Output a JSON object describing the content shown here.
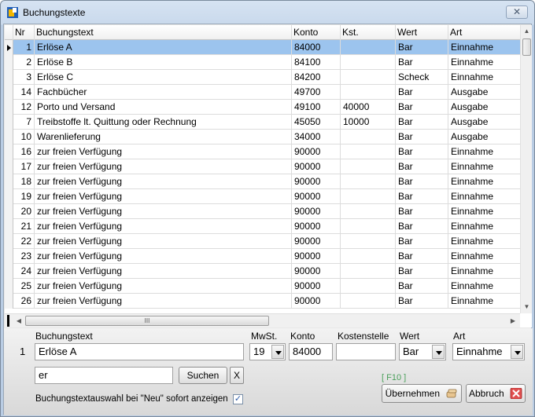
{
  "window": {
    "title": "Buchungstexte",
    "close_label": "✕"
  },
  "grid": {
    "columns": {
      "nr": "Nr",
      "text": "Buchungstext",
      "konto": "Konto",
      "kst": "Kst.",
      "wert": "Wert",
      "art": "Art"
    },
    "rows": [
      {
        "nr": "1",
        "text": "Erlöse A",
        "konto": "84000",
        "kst": "",
        "wert": "Bar",
        "art": "Einnahme"
      },
      {
        "nr": "2",
        "text": "Erlöse B",
        "konto": "84100",
        "kst": "",
        "wert": "Bar",
        "art": "Einnahme"
      },
      {
        "nr": "3",
        "text": "Erlöse C",
        "konto": "84200",
        "kst": "",
        "wert": "Scheck",
        "art": "Einnahme"
      },
      {
        "nr": "14",
        "text": "Fachbücher",
        "konto": "49700",
        "kst": "",
        "wert": "Bar",
        "art": "Ausgabe"
      },
      {
        "nr": "12",
        "text": "Porto und Versand",
        "konto": "49100",
        "kst": "40000",
        "wert": "Bar",
        "art": "Ausgabe"
      },
      {
        "nr": "7",
        "text": "Treibstoffe lt. Quittung oder Rechnung",
        "konto": "45050",
        "kst": "10000",
        "wert": "Bar",
        "art": "Ausgabe"
      },
      {
        "nr": "10",
        "text": "Warenlieferung",
        "konto": "34000",
        "kst": "",
        "wert": "Bar",
        "art": "Ausgabe"
      },
      {
        "nr": "16",
        "text": "zur freien Verfügung",
        "konto": "90000",
        "kst": "",
        "wert": "Bar",
        "art": "Einnahme"
      },
      {
        "nr": "17",
        "text": "zur freien Verfügung",
        "konto": "90000",
        "kst": "",
        "wert": "Bar",
        "art": "Einnahme"
      },
      {
        "nr": "18",
        "text": "zur freien Verfügung",
        "konto": "90000",
        "kst": "",
        "wert": "Bar",
        "art": "Einnahme"
      },
      {
        "nr": "19",
        "text": "zur freien Verfügung",
        "konto": "90000",
        "kst": "",
        "wert": "Bar",
        "art": "Einnahme"
      },
      {
        "nr": "20",
        "text": "zur freien Verfügung",
        "konto": "90000",
        "kst": "",
        "wert": "Bar",
        "art": "Einnahme"
      },
      {
        "nr": "21",
        "text": "zur freien Verfügung",
        "konto": "90000",
        "kst": "",
        "wert": "Bar",
        "art": "Einnahme"
      },
      {
        "nr": "22",
        "text": "zur freien Verfügung",
        "konto": "90000",
        "kst": "",
        "wert": "Bar",
        "art": "Einnahme"
      },
      {
        "nr": "23",
        "text": "zur freien Verfügung",
        "konto": "90000",
        "kst": "",
        "wert": "Bar",
        "art": "Einnahme"
      },
      {
        "nr": "24",
        "text": "zur freien Verfügung",
        "konto": "90000",
        "kst": "",
        "wert": "Bar",
        "art": "Einnahme"
      },
      {
        "nr": "25",
        "text": "zur freien Verfügung",
        "konto": "90000",
        "kst": "",
        "wert": "Bar",
        "art": "Einnahme"
      },
      {
        "nr": "26",
        "text": "zur freien Verfügung",
        "konto": "90000",
        "kst": "",
        "wert": "Bar",
        "art": "Einnahme"
      }
    ],
    "selected_row": 0,
    "hscroll_grip": "III"
  },
  "editor": {
    "labels": {
      "text": "Buchungstext",
      "mwst": "MwSt.",
      "konto": "Konto",
      "kst": "Kostenstelle",
      "wert": "Wert",
      "art": "Art"
    },
    "nr": "1",
    "text": "Erlöse A",
    "mwst": "19",
    "konto": "84000",
    "kst": "",
    "wert": "Bar",
    "art": "Einnahme"
  },
  "search": {
    "value": "er",
    "button": "Suchen",
    "clear": "X"
  },
  "option": {
    "label": "Buchungstextauswahl bei \"Neu\" sofort anzeigen",
    "checked": "✓"
  },
  "actions": {
    "hint": "[ F10 ]",
    "apply": "Übernehmen",
    "cancel": "Abbruch"
  },
  "colors": {
    "selected_row": "#9cc4ee",
    "hint": "#4aa05a",
    "cancel_icon": "#e05050"
  }
}
